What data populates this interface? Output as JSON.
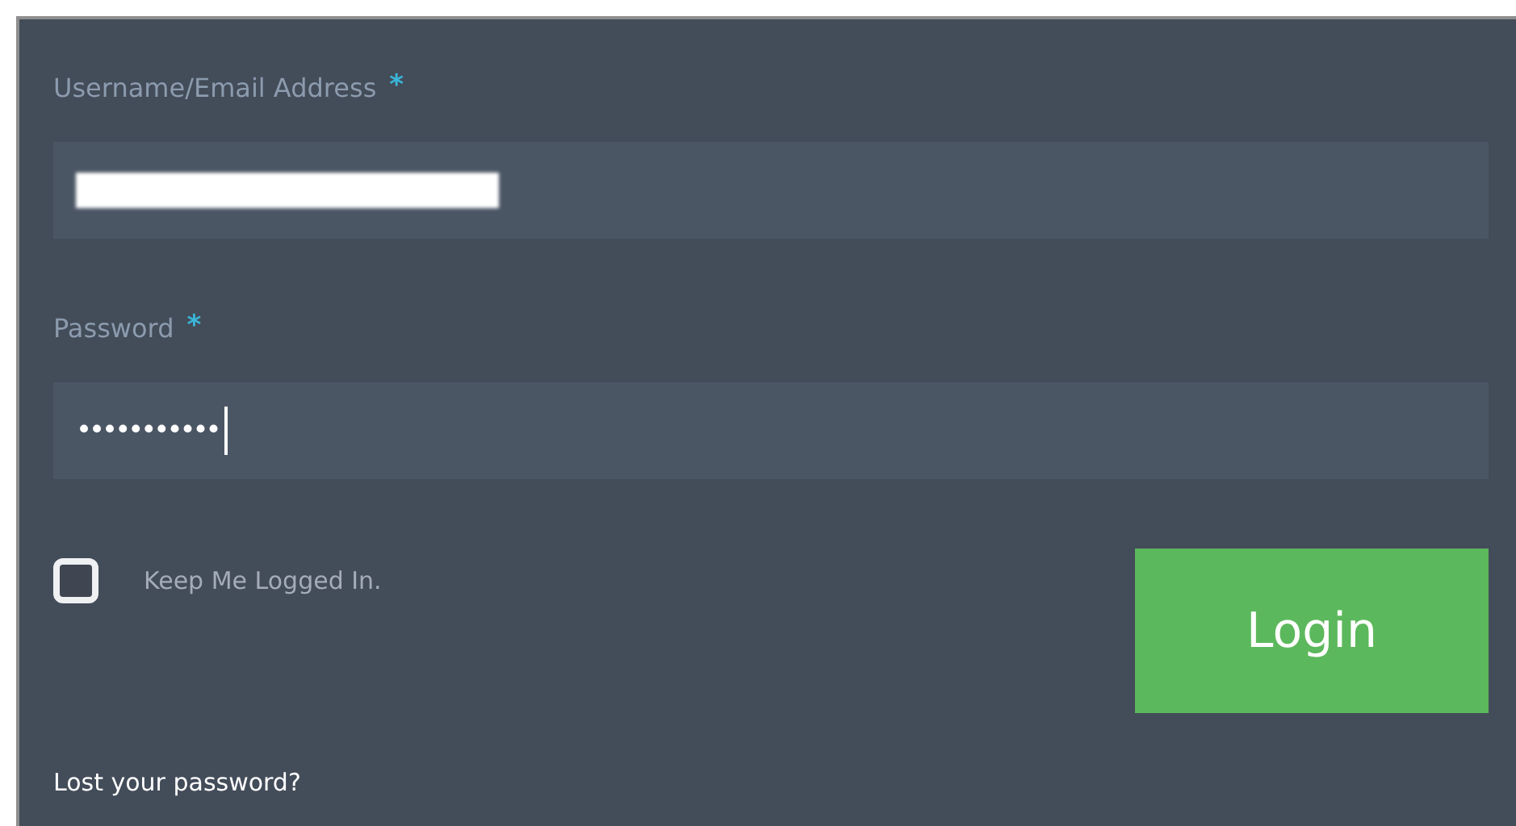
{
  "fields": [
    {
      "label": "Username/Email Address",
      "required_mark": "*",
      "kind": "redacted",
      "focused": false
    },
    {
      "label": "Password",
      "required_mark": "*",
      "kind": "text",
      "value": "•••••••••••",
      "focused": true
    }
  ],
  "remember": {
    "label": "Keep Me Logged In.",
    "checked": false
  },
  "login_button": "Login",
  "lost_password_link": "Lost your password?"
}
